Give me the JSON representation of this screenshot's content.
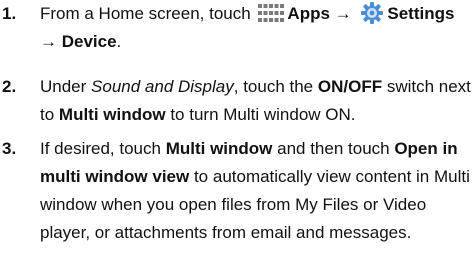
{
  "steps": [
    {
      "number": "1.",
      "text_1": "From a Home screen, touch ",
      "apps_label": "Apps",
      "arrow_1": " → ",
      "settings_label": "Settings",
      "arrow_2": "→ Device",
      "end": "."
    },
    {
      "number": "2.",
      "text_1": "Under ",
      "section_name": "Sound and Display",
      "text_2": ", touch the ",
      "switch_name": "ON/OFF",
      "text_3": " switch next to ",
      "setting_name": "Multi window",
      "text_4": " to turn Multi window ON."
    },
    {
      "number": "3.",
      "text_1": "If desired, touch ",
      "setting_name": "Multi window",
      "text_2": " and then touch ",
      "option_name": "Open in multi window view",
      "text_3": " to automatically view content in Multi window when you open files from My Files or Video player, or attachments from email and messages."
    }
  ],
  "icons": {
    "apps": "apps-grid-icon",
    "settings": "settings-gear-icon"
  },
  "colors": {
    "icon_grid": "#7a7a7a",
    "icon_gear_outer": "#4a8fd6",
    "icon_gear_inner": "#cfe3f7",
    "text": "#111111"
  }
}
